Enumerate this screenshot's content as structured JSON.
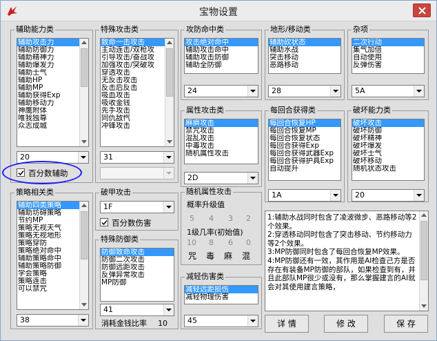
{
  "window": {
    "title": "宝物设置",
    "icon": "red-bird-icon"
  },
  "assist_ability": {
    "label": "辅助能力类",
    "items": [
      "辅助攻击力",
      "辅助防御力",
      "辅助精神力",
      "辅助爆发力",
      "辅助士气",
      "辅助HP",
      "辅助MP",
      "辅助获得Exp",
      "辅助移动力",
      "神鹰附体",
      "唯我独尊",
      "众志成城"
    ],
    "selected_index": 0,
    "combo_value": "20",
    "checkbox_label": "百分数辅助",
    "checkbox_checked": true
  },
  "special_attack": {
    "label": "特殊攻击类",
    "items": [
      "致命一击攻击",
      "主动连击/双枪攻",
      "引导攻击/奋战攻",
      "加强攻击/突破攻",
      "穿透攻击",
      "无反击攻击",
      "反击后反击",
      "吸血攻击",
      "吸收金钱",
      "先手攻击",
      "同仇敌忾",
      "冲锋攻击"
    ],
    "selected_index": 0,
    "combo_value": "31",
    "combo2_value": ""
  },
  "attack_defense_hit": {
    "label": "攻防命中类",
    "items": [
      "攻击绝对命中",
      "辅助攻击命中",
      "辅助攻击防御",
      "辅助全防御"
    ],
    "selected_index": 0,
    "combo_value": "24"
  },
  "terrain_move": {
    "label": "地形/移动类",
    "items": [
      "辅助砍状态",
      "辅助水战",
      "突击移动",
      "恶路移动"
    ],
    "selected_index": 0,
    "combo_value": "28"
  },
  "misc": {
    "label": "杂项",
    "items": [
      "二次行动",
      "集气加倍",
      "自动使用",
      "反弹伤害"
    ],
    "selected_index": 0,
    "combo_value": "5A"
  },
  "attribute_attack": {
    "label": "属性攻击类",
    "items": [
      "麻痹攻击",
      "禁咒攻击",
      "混乱攻击",
      "中毒攻击",
      "随机属性攻击"
    ],
    "selected_index": 0,
    "combo_value": "2D"
  },
  "per_turn_gain": {
    "label": "每回合获得类",
    "items": [
      "每回合恢复HP",
      "每回合恢复MP",
      "每回合恢复状态",
      "每回合获得Exp",
      "每回合获得武器Exp",
      "每回合获得护具Exp",
      "自动提升"
    ],
    "selected_index": 0,
    "combo_value": "1A"
  },
  "break_ability": {
    "label": "破坏能力类",
    "items": [
      "破坏攻击",
      "破坏防御",
      "破坏精神",
      "破坏爆发",
      "破坏士气",
      "破坏移动",
      "随机状态攻击"
    ],
    "selected_index": 0,
    "combo_value": "20"
  },
  "strategy": {
    "label": "策略相关类",
    "items": [
      "辅助四类策略",
      "辅助坊碍策略",
      "节约MP",
      "策略无视天气",
      "策略无视地形",
      "策略穿防",
      "策略绝对命中",
      "辅助策略命中",
      "辅助策略防御",
      "学会策略",
      "策略连击",
      "可以禁咒"
    ],
    "selected_index": 0,
    "combo_value": "38"
  },
  "break_attack": {
    "label": "破甲攻击",
    "combo_value": "1F",
    "checkbox_label": "百分数伤害",
    "checkbox_checked": true
  },
  "random_attr": {
    "label": "随机属性攻击",
    "upgrade_label": "概率升级值",
    "upgrade_values": [
      "5",
      "4",
      "3",
      "2"
    ],
    "init_label": "1级几率(初始值)",
    "init_values": [
      "10",
      "8",
      "6",
      "0"
    ],
    "effect_labels": [
      "咒",
      "毒",
      "麻",
      "混"
    ]
  },
  "special_defense": {
    "label": "特殊防御类",
    "items": [
      "防御致命攻击",
      "防御二次攻击",
      "防御远距攻击",
      "反弹异常攻击",
      "MP防御"
    ],
    "selected_index": 0,
    "combo_value": "41",
    "cost_label": "消耗金钱比率",
    "cost_value": "10"
  },
  "reduce_damage": {
    "label": "减轻伤害类",
    "items": [
      "减轻远距损伤",
      "减轻物理伤害"
    ],
    "selected_index": 0,
    "combo_value": "45"
  },
  "description": "1:辅助水战同时包含了凌波微步、恶路移动等2个效果。\n2:穿透移动同时包含了突击移动、节约移动力等2个效果。\n3:MP防御同时包含了每回合恢复MP效果。\n4:MP防御还有一效，其作用是AI检查己方是否存在有装备MP防御的部队，如果检查到有，并且此部队MP很少或没有，那么掌握建言的AI就会对其使用建言策略，",
  "buttons": {
    "details": "详 情",
    "modify": "修 改",
    "save": "保 存"
  }
}
